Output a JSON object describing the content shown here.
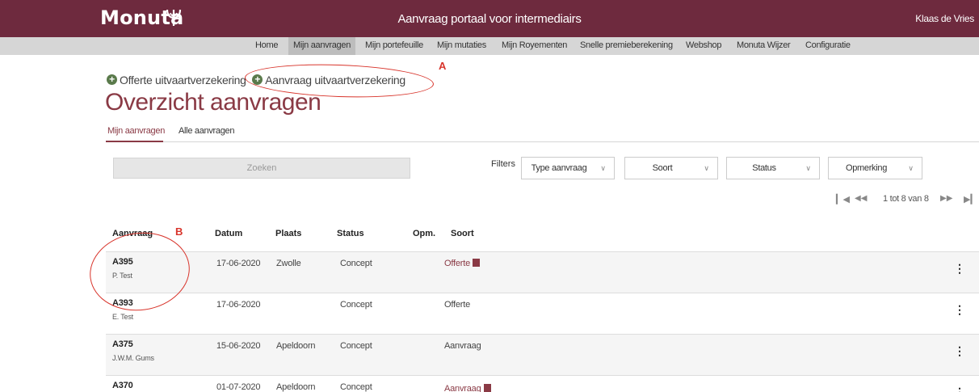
{
  "header": {
    "logo": "Monuta",
    "portal_title": "Aanvraag portaal voor intermediairs",
    "user": "Klaas de Vries"
  },
  "nav": {
    "items": [
      "Home",
      "Mijn aanvragen",
      "Mijn portefeuille",
      "Mijn mutaties",
      "Mijn Royementen",
      "Snelle premieberekening",
      "Webshop",
      "Monuta Wijzer",
      "Configuratie"
    ],
    "active": "Mijn aanvragen"
  },
  "actions": {
    "offerte": "Offerte uitvaartverzekering",
    "aanvraag": "Aanvraag uitvaartverzekering"
  },
  "page_title": "Overzicht aanvragen",
  "tabs": {
    "mine": "Mijn aanvragen",
    "all": "Alle aanvragen"
  },
  "search": {
    "label": "Zoeken"
  },
  "filters": {
    "label": "Filters",
    "type": "Type aanvraag",
    "soort": "Soort",
    "status": "Status",
    "opmerking": "Opmerking"
  },
  "pagination": {
    "text": "1 tot 8 van 8"
  },
  "table": {
    "headers": {
      "aanvraag": "Aanvraag",
      "datum": "Datum",
      "plaats": "Plaats",
      "status": "Status",
      "opm": "Opm.",
      "soort": "Soort"
    },
    "rows": [
      {
        "code": "A395",
        "person": "P. Test",
        "datum": "17-06-2020",
        "plaats": "Zwolle",
        "status": "Concept",
        "soort": "Offerte",
        "pdf": true
      },
      {
        "code": "A393",
        "person": "E. Test",
        "datum": "17-06-2020",
        "plaats": "",
        "status": "Concept",
        "soort": "Offerte",
        "pdf": false
      },
      {
        "code": "A375",
        "person": "J.W.M. Gums",
        "datum": "15-06-2020",
        "plaats": "Apeldoorn",
        "status": "Concept",
        "soort": "Aanvraag",
        "pdf": false
      },
      {
        "code": "A370",
        "person": "",
        "datum": "01-07-2020",
        "plaats": "Apeldoorn",
        "status": "Concept",
        "soort": "Aanvraag",
        "pdf": true
      }
    ]
  },
  "annotations": {
    "a": "A",
    "b": "B"
  },
  "colors": {
    "brand": "#6e2a3e",
    "accent": "#8a3a45",
    "nav_bg": "#d6d6d6",
    "annotation": "#d8342b",
    "plus_icon": "#5a7a4b"
  }
}
